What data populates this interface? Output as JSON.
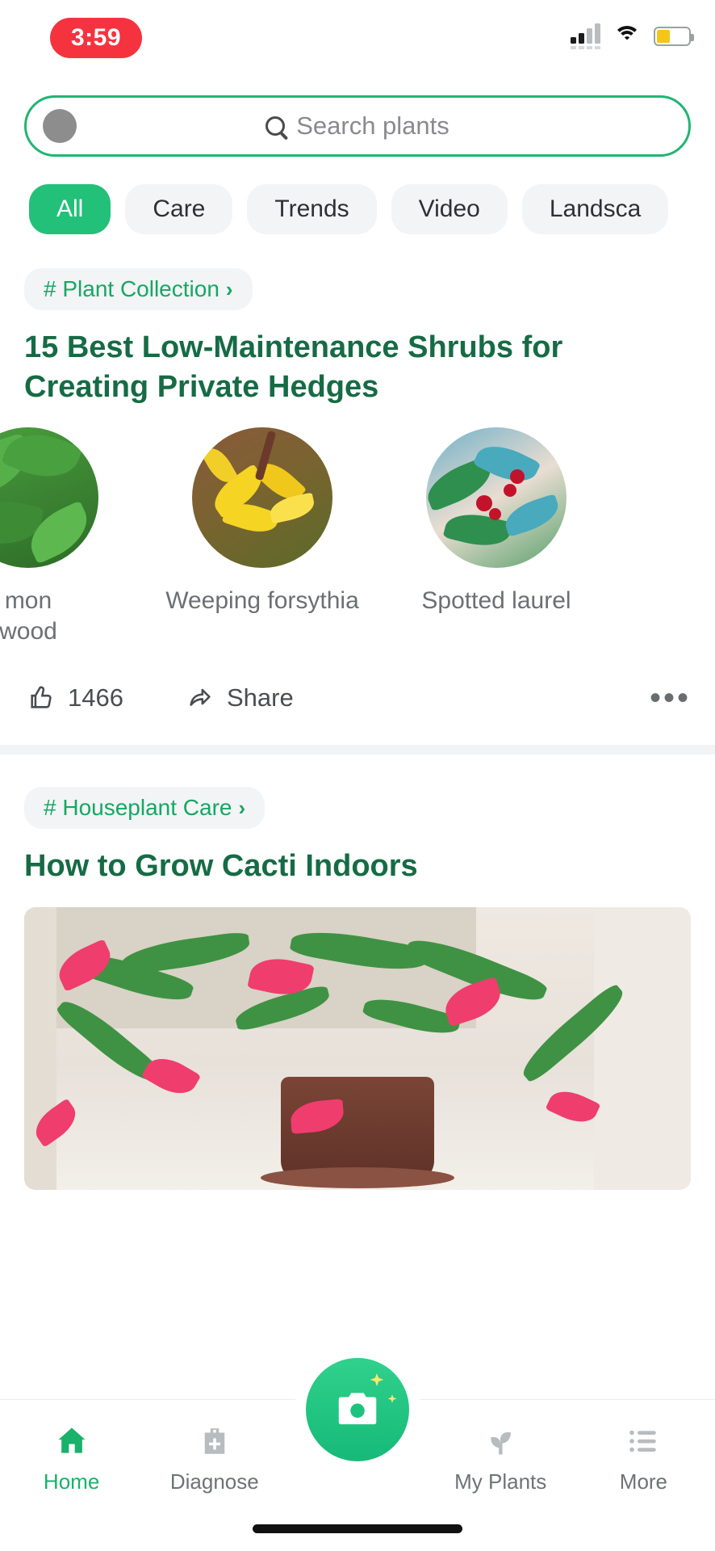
{
  "statusbar": {
    "time": "3:59",
    "signal_icon": "signal-bars-icon",
    "wifi_icon": "wifi-icon",
    "battery_icon": "battery-icon",
    "recording_pill_color": "#f5333f",
    "battery_fill_color": "#f5c518"
  },
  "search": {
    "placeholder": "Search plants",
    "icon": "search-icon",
    "avatar_icon": "avatar-icon",
    "border_color": "#22b573"
  },
  "filters": {
    "chips": [
      {
        "label": "All",
        "active": true
      },
      {
        "label": "Care",
        "active": false
      },
      {
        "label": "Trends",
        "active": false
      },
      {
        "label": "Video",
        "active": false
      },
      {
        "label": "Landsca",
        "active": false
      }
    ],
    "active_color": "#22c079"
  },
  "feed": {
    "cards": [
      {
        "tag": "# Plant Collection",
        "tag_chevron": "›",
        "title": "15 Best Low-Maintenance Shrubs for Creating Private Hedges",
        "plants": [
          {
            "label": "mon\nwood",
            "thumb": "common-boxwood-thumb"
          },
          {
            "label": "Weeping forsythia",
            "thumb": "weeping-forsythia-thumb"
          },
          {
            "label": "Spotted laurel",
            "thumb": "spotted-laurel-thumb"
          }
        ],
        "likes": "1466",
        "like_icon": "thumbs-up-icon",
        "share_label": "Share",
        "share_icon": "share-icon",
        "more_icon": "more-dots-icon",
        "more_label": "•••"
      },
      {
        "tag": "# Houseplant Care",
        "tag_chevron": "›",
        "title": "How to Grow Cacti Indoors",
        "hero_image": "christmas-cactus-photo"
      }
    ],
    "title_color": "#166b45",
    "tag_color": "#16a765"
  },
  "bottomnav": {
    "items": [
      {
        "label": "Home",
        "icon": "home-icon",
        "active": true
      },
      {
        "label": "Diagnose",
        "icon": "medical-kit-icon",
        "active": false
      },
      {
        "label": "My Plants",
        "icon": "seedling-icon",
        "active": false
      },
      {
        "label": "More",
        "icon": "list-icon",
        "active": false
      }
    ],
    "camera_button_icon": "camera-icon",
    "accent_color": "#18b26a"
  }
}
